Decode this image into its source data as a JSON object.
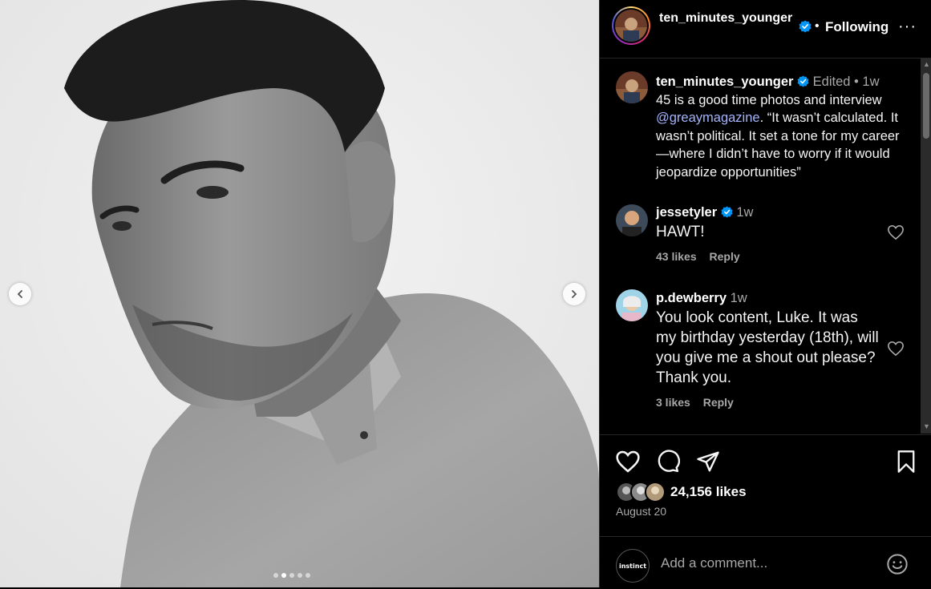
{
  "post": {
    "username": "ten_minutes_younger",
    "follow_status": "Following",
    "separator": "•",
    "more": "···",
    "carousel": {
      "slides": 5,
      "active": 1
    }
  },
  "caption": {
    "username": "ten_minutes_younger",
    "edited": "Edited",
    "dot": "•",
    "age": "1w",
    "text_before": "45 is a good time  photos and interview ",
    "mention": "@greaymagazine",
    "text_after": ". “It wasn’t calculated. It wasn’t political. It set a tone for my career—where I didn’t have to worry if it would jeopardize opportunities”"
  },
  "comments": [
    {
      "username": "jessetyler",
      "verified": true,
      "age": "1w",
      "text": "HAWT!",
      "likes": "43 likes",
      "reply": "Reply"
    },
    {
      "username": "p.dewberry",
      "verified": false,
      "age": "1w",
      "text": "You look content, Luke. It was my birthday yesterday (18th), will you give me a shout out please? Thank you.",
      "likes": "3 likes",
      "reply": "Reply"
    }
  ],
  "stats": {
    "likes": "24,156 likes",
    "date": "August 20"
  },
  "composer": {
    "placeholder": "Add a comment...",
    "avatar_text": "instinct"
  },
  "icons": {
    "prev": "chevron-left-icon",
    "next": "chevron-right-icon",
    "like": "heart-icon",
    "comment": "comment-icon",
    "share": "paper-plane-icon",
    "save": "bookmark-icon",
    "emoji": "emoji-icon",
    "verified": "verified-badge-icon"
  },
  "colors": {
    "verified": "#0095f6",
    "mention": "#a5b4fc",
    "muted": "#a8a8a8"
  }
}
